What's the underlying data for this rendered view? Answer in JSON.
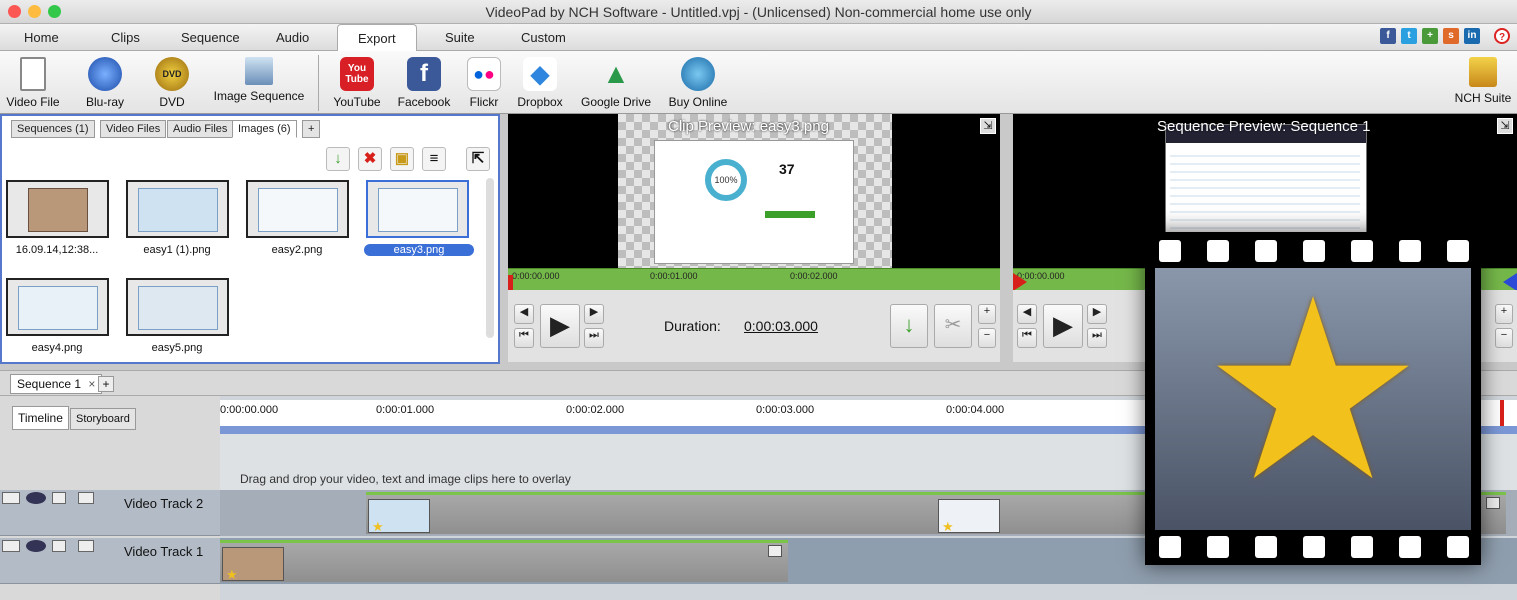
{
  "window": {
    "title": "VideoPad by NCH Software - Untitled.vpj - (Unlicensed) Non-commercial home use only"
  },
  "menu": [
    "Home",
    "Clips",
    "Sequence",
    "Audio",
    "Export",
    "Suite",
    "Custom"
  ],
  "toolbar": {
    "video_file": "Video File",
    "bluray": "Blu-ray",
    "dvd": "DVD",
    "image_sequence": "Image Sequence",
    "youtube": "YouTube",
    "facebook": "Facebook",
    "flickr": "Flickr",
    "dropbox": "Dropbox",
    "google_drive": "Google Drive",
    "buy_online": "Buy Online",
    "nch_suite": "NCH Suite",
    "youtube_badge": "You Tube",
    "dvd_badge": "DVD"
  },
  "bin": {
    "tabs": [
      "Sequences (1)",
      "Video Files",
      "Audio Files",
      "Images (6)"
    ],
    "add_tab": "+",
    "items": [
      "16.09.14,12:38...",
      "easy1 (1).png",
      "easy2.png",
      "easy3.png",
      "easy4.png",
      "easy5.png"
    ]
  },
  "clip_preview": {
    "title": "Clip Preview: easy3.png",
    "duration_label": "Duration:",
    "duration_value": "0:00:03.000",
    "ticks": [
      "0:00:00.000",
      "0:00:01.000",
      "0:00:02.000"
    ],
    "screen_number": "37",
    "screen_percent": "100%"
  },
  "sequence_preview": {
    "title": "Sequence Preview: Sequence 1",
    "ticks": [
      "0:00:00.000"
    ]
  },
  "sequence_tab": {
    "label": "Sequence 1",
    "close": "×",
    "add": "+"
  },
  "timeline": {
    "tabs": [
      "Timeline",
      "Storyboard"
    ],
    "ticks": [
      "0:00:00.000",
      "0:00:01.000",
      "0:00:02.000",
      "0:00:03.000",
      "0:00:04.000"
    ],
    "overlay_hint": "Drag and drop your video, text and image clips here to overlay",
    "tracks": [
      "Video Track 2",
      "Video Track 1"
    ]
  },
  "colors": {
    "accent": "#3b6fd8",
    "ruler_green": "#75b84a",
    "track_clip": "#9a9a9a"
  }
}
